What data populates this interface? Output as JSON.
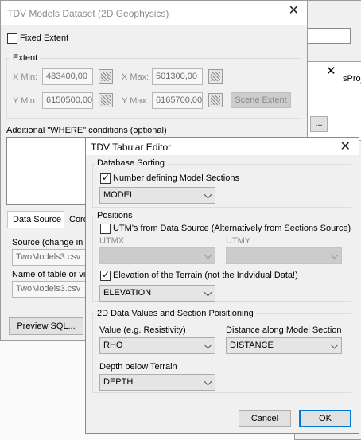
{
  "bg_window": {
    "fragment_label": "sProj",
    "browse_label": "..."
  },
  "models_dialog": {
    "title": "TDV Models Dataset (2D Geophysics)",
    "fixed_extent_label": "Fixed Extent",
    "fixed_extent_checked": false,
    "extent_group_label": "Extent",
    "x_min_label": "X Min:",
    "x_min_value": "483400,00",
    "x_max_label": "X Max:",
    "x_max_value": "501300,00",
    "y_min_label": "Y Min:",
    "y_min_value": "6150500,00",
    "y_max_label": "Y Max:",
    "y_max_value": "6165700,00",
    "scene_extent_label": "Scene Extent",
    "where_label": "Additional \"WHERE\" conditions (optional)",
    "tabs": [
      "Data Source",
      "Cord"
    ],
    "source_label": "Source (change in D",
    "source_value": "TwoModels3.csv",
    "table_label": "Name of table or vie",
    "table_value": "TwoModels3.csv",
    "preview_label": "Preview SQL..."
  },
  "tabular_editor": {
    "title": "TDV Tabular Editor",
    "db_sorting_label": "Database Sorting",
    "number_sections_label": "Number defining Model Sections",
    "number_sections_checked": true,
    "model_value": "MODEL",
    "positions_label": "Positions",
    "utm_label": "UTM's from Data Source (Alternatively from Sections Source)",
    "utm_checked": false,
    "utmx_label": "UTMX",
    "utmy_label": "UTMY",
    "utmx_value": "",
    "utmy_value": "",
    "elevation_check_label": "Elevation of the Terrain (not the Indvidual Data!)",
    "elevation_checked": true,
    "elevation_value": "ELEVATION",
    "values_group_label": "2D Data Values and Section Poisitioning",
    "value_label": "Value (e.g. Resistivity)",
    "value_value": "RHO",
    "distance_label": "Distance along Model Section",
    "distance_value": "DISTANCE",
    "depth_label": "Depth below Terrain",
    "depth_value": "DEPTH",
    "cancel_label": "Cancel",
    "ok_label": "OK"
  }
}
